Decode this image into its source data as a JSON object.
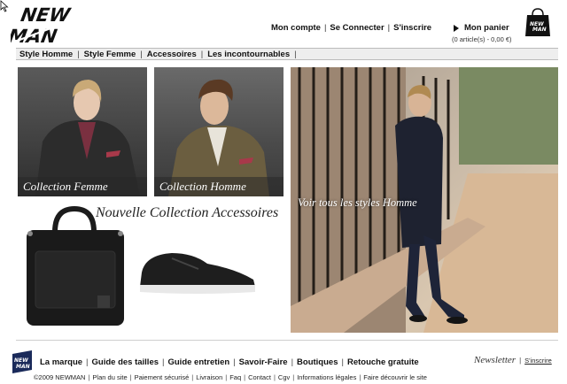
{
  "brand": {
    "logo_text_line1": "NEW",
    "logo_text_line2": "MAN"
  },
  "header": {
    "links": [
      {
        "label": "Mon compte"
      },
      {
        "label": "Se Connecter"
      },
      {
        "label": "S'inscrire"
      }
    ],
    "cart": {
      "label": "Mon panier",
      "summary": "(0 article(s) - 0,00 €)"
    }
  },
  "nav": {
    "items": [
      {
        "label": "Style Homme"
      },
      {
        "label": "Style Femme"
      },
      {
        "label": "Accessoires"
      },
      {
        "label": "Les incontournables"
      }
    ],
    "separator": "|"
  },
  "panels": {
    "femme": {
      "caption": "Collection Femme"
    },
    "homme": {
      "caption": "Collection Homme"
    },
    "accessoires": {
      "title": "Nouvelle Collection Accessoires"
    },
    "styles": {
      "caption": "Voir tous les styles Homme"
    }
  },
  "footer": {
    "links": [
      {
        "label": "La marque"
      },
      {
        "label": "Guide des tailles"
      },
      {
        "label": "Guide entretien"
      },
      {
        "label": "Savoir-Faire"
      },
      {
        "label": "Boutiques"
      },
      {
        "label": "Retouche gratuite"
      }
    ],
    "newsletter": {
      "label": "Newsletter",
      "signup": "S'inscrire"
    },
    "legal": [
      {
        "label": "©2009 NEWMAN"
      },
      {
        "label": "Plan du site"
      },
      {
        "label": "Paiement sécurisé"
      },
      {
        "label": "Livraison"
      },
      {
        "label": "Faq"
      },
      {
        "label": "Contact"
      },
      {
        "label": "Cgv"
      },
      {
        "label": "Informations légales"
      },
      {
        "label": "Faire découvrir le site"
      }
    ]
  },
  "colors": {
    "text": "#111111",
    "nav_bg": "#eeeeee",
    "caption_overlay": "rgba(40,40,40,0.55)"
  }
}
